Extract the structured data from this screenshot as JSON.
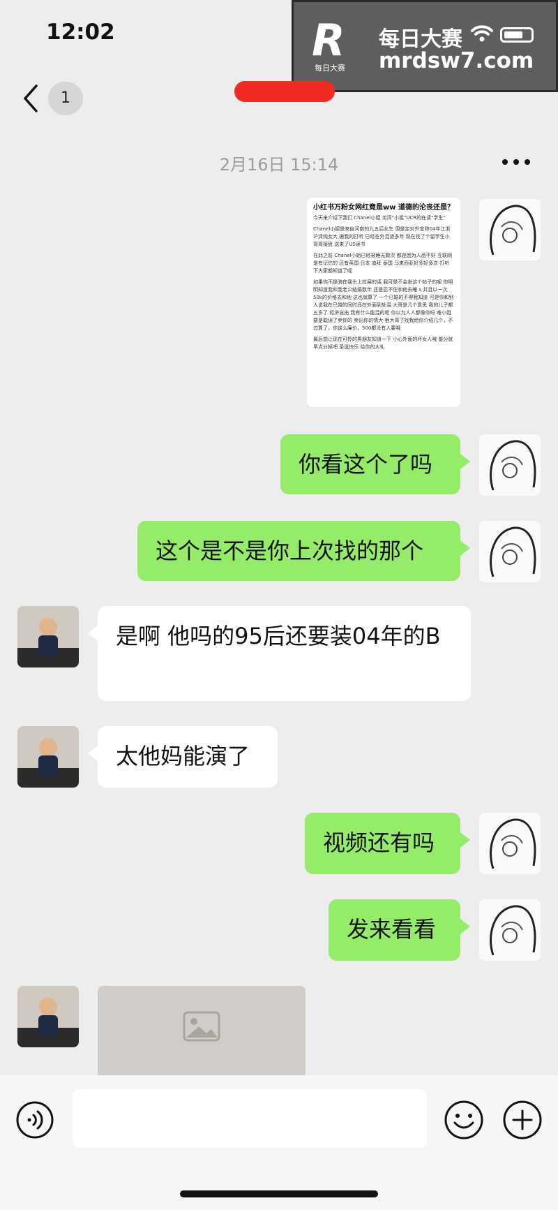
{
  "status_bar": {
    "time": "12:02",
    "watermark": {
      "logo": "R",
      "logo_sub": "每日大赛",
      "title": "每日大赛",
      "url": "mrdsw7.com"
    }
  },
  "header": {
    "unread_count": "1",
    "contact_name": ""
  },
  "timestamp": "2月16日 15:14",
  "screenshot": {
    "title": "小红书万粉女网红竟是ww 道德的沦丧还是？",
    "paragraphs": [
      "今天来介绍下我们 Chanel小姐 龙湾\"小姐\"UCR的在读\"学生\"",
      "Chanel小姐是来自河南的九五后女生 但是定对外宣称04年江浙沪清纯女大 据我的打听 已经在外混迹多年 现在找了个留学生小哥哥接盘 送来了US读书",
      "在此之前 Chanel小姐已经被睡无数次 都是因为人品不好 互联网是有记忆的 还有英国 日本 迪拜 泰国 马来西亚好多好多次 打听下大家都知道了呢",
      "如果你不是骑在我头上拉屎的话 我可是不会发这个帖子的呢 你明明知道我和我老公结婚数年 还是忍不住和他去睡 s 并且以一次50k的价格去和他 这也就算了 一个已婚的不得我知道 可是你和别人说我在已婚的同时还在外面到处混 大哥是几个意思 我的儿子都五岁了 经济自由 我有什么能混的呢 你以为人人都像你吗 难小姐 要是耽误了卖你的 卖出你的情大 狠大哥了找我给你介绍几个，不过算了，你这么廉价，500都没有人要哦",
      "最后想让现在可怜的男朋友知道一下 小心外面的坏女人哦 能分就早点分掉吧 圣诞快乐 给你的大礼"
    ]
  },
  "messages": [
    {
      "sender": "self",
      "text": "你看这个了吗"
    },
    {
      "sender": "self",
      "text": "这个是不是你上次找的那个"
    },
    {
      "sender": "contact",
      "text": "是啊 他吗的95后还要装04年的B"
    },
    {
      "sender": "contact",
      "text": "太他妈能演了"
    },
    {
      "sender": "self",
      "text": "视频还有吗"
    },
    {
      "sender": "self",
      "text": "发来看看"
    }
  ],
  "input_bar": {
    "message": ""
  },
  "colors": {
    "background": "#ededed",
    "sent_bubble": "#95ec69",
    "received_bubble": "#ffffff",
    "name_redaction": "#f02b22"
  }
}
